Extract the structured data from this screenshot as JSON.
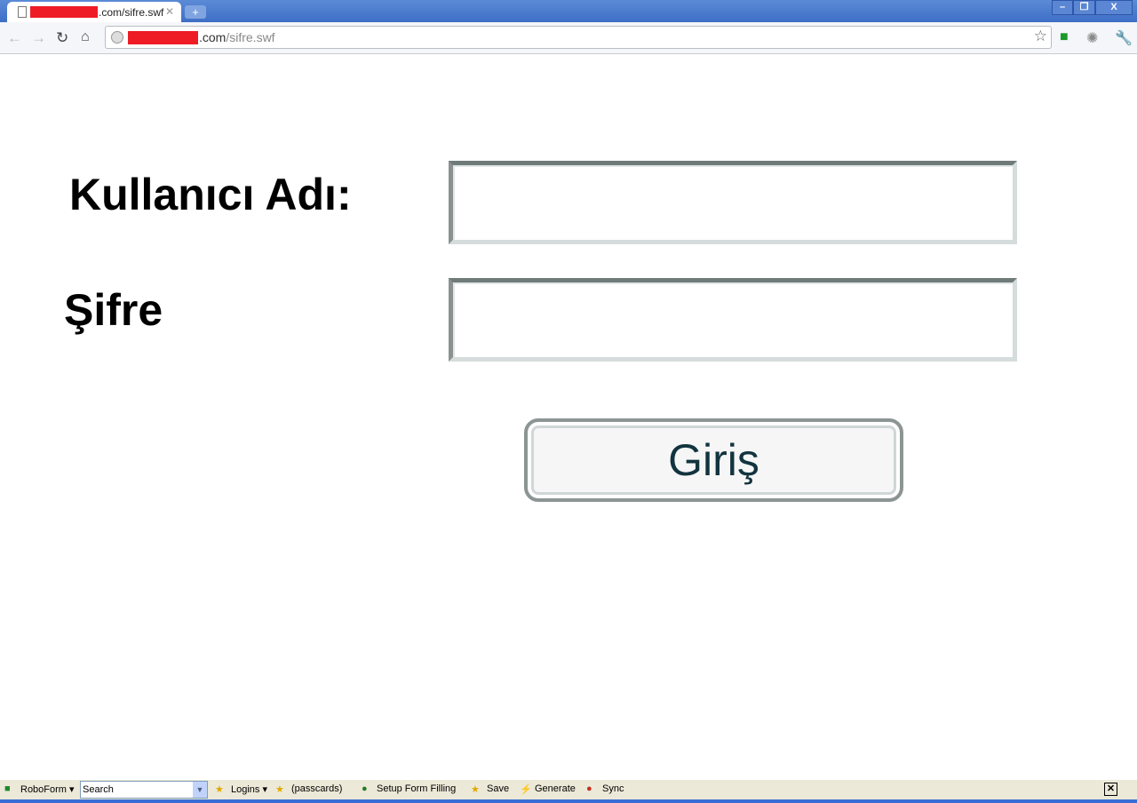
{
  "browser": {
    "tab_title": ".com/sifre.swf",
    "new_tab": "+",
    "url_domain": ".com",
    "url_path": "/sifre.swf",
    "window_buttons": {
      "minimize": "–",
      "restore": "❐",
      "close": "X"
    }
  },
  "form": {
    "username_label": "Kullanıcı Adı:",
    "username_value": "",
    "password_label": "Şifre",
    "password_value": "",
    "submit_label": "Giriş"
  },
  "roboform": {
    "brand": "RoboForm",
    "search_placeholder": "Search",
    "logins": "Logins",
    "passcards": "(passcards)",
    "setup": "Setup Form Filling",
    "save": "Save",
    "generate": "Generate",
    "sync": "Sync",
    "close": "✕"
  }
}
